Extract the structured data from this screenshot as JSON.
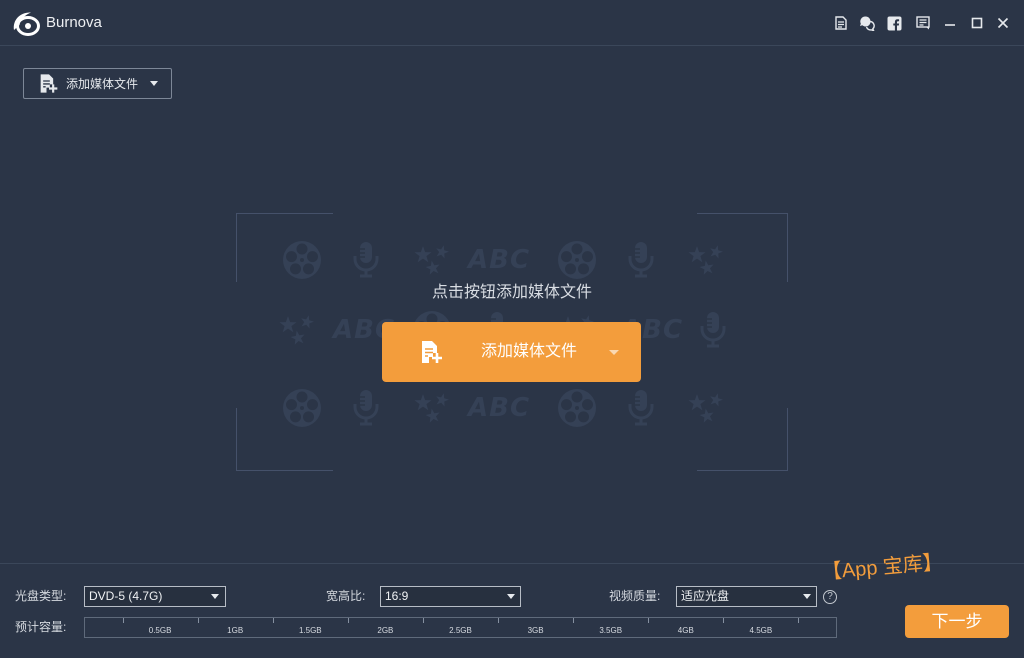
{
  "titlebar": {
    "app_name": "Burnova",
    "logo_icon": "burnova-logo",
    "action_icons": [
      "file-icon",
      "feedback-icon",
      "facebook-icon",
      "menu-icon"
    ],
    "window_controls": [
      "minimize-icon",
      "maximize-icon",
      "close-icon"
    ]
  },
  "toolbar": {
    "add_media_label": "添加媒体文件",
    "add_media_icon": "add-file-icon",
    "dropdown_icon": "caret-down-icon"
  },
  "dropzone": {
    "hint": "点击按钮添加媒体文件",
    "add_button_label": "添加媒体文件",
    "pattern_text": "ABC",
    "pattern_icons": [
      "film-reel-icon",
      "microphone-icon",
      "stars-icon"
    ]
  },
  "settings": {
    "disc_type": {
      "label": "光盘类型:",
      "value": "DVD-5 (4.7G)"
    },
    "aspect_ratio": {
      "label": "宽高比:",
      "value": "16:9"
    },
    "video_quality": {
      "label": "视频质量:",
      "value": "适应光盘"
    },
    "help": "?"
  },
  "capacity": {
    "label": "预计容量:",
    "ticks": [
      "0.5GB",
      "1GB",
      "1.5GB",
      "2GB",
      "2.5GB",
      "3GB",
      "3.5GB",
      "4GB",
      "4.5GB"
    ],
    "used_fraction": 0
  },
  "next_button": {
    "label": "下一步"
  },
  "watermark": {
    "text": "【App 宝库】"
  },
  "colors": {
    "background": "#2b3547",
    "accent": "#f39d3c",
    "text": "#d6dae0"
  }
}
